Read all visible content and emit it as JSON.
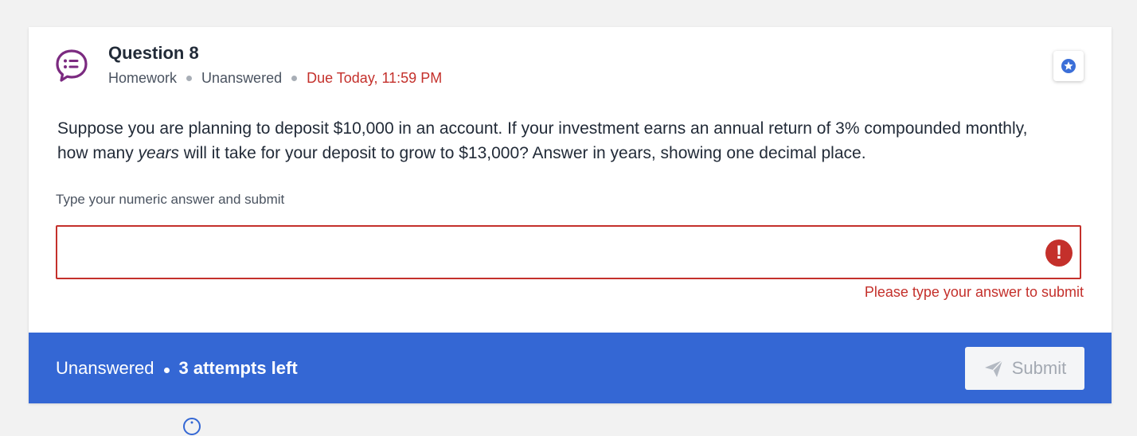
{
  "question": {
    "title": "Question 8",
    "type": "Homework",
    "status": "Unanswered",
    "due": "Due Today, 11:59 PM",
    "text_part1": "Suppose you are planning to deposit $10,000 in an account. If your investment earns an annual return of 3% compounded monthly, how many ",
    "text_emphasis": "years",
    "text_part2": " will it take for your deposit to grow to $13,000? Answer in years, showing one decimal place."
  },
  "answer": {
    "label": "Type your numeric answer and submit",
    "value": "",
    "placeholder": "",
    "error_message": "Please type your answer to submit",
    "error_icon_glyph": "!"
  },
  "footer": {
    "status": "Unanswered",
    "attempts": "3 attempts left",
    "submit_label": "Submit"
  },
  "icons": {
    "question": "chat-list-icon",
    "bookmark": "star-badge-icon",
    "error": "exclamation-icon",
    "submit": "paper-plane-icon",
    "below": "info-icon"
  },
  "colors": {
    "accent_purple": "#7b2a80",
    "error_red": "#c4302b",
    "footer_blue": "#3467d4",
    "star_blue": "#3b6fd8"
  }
}
